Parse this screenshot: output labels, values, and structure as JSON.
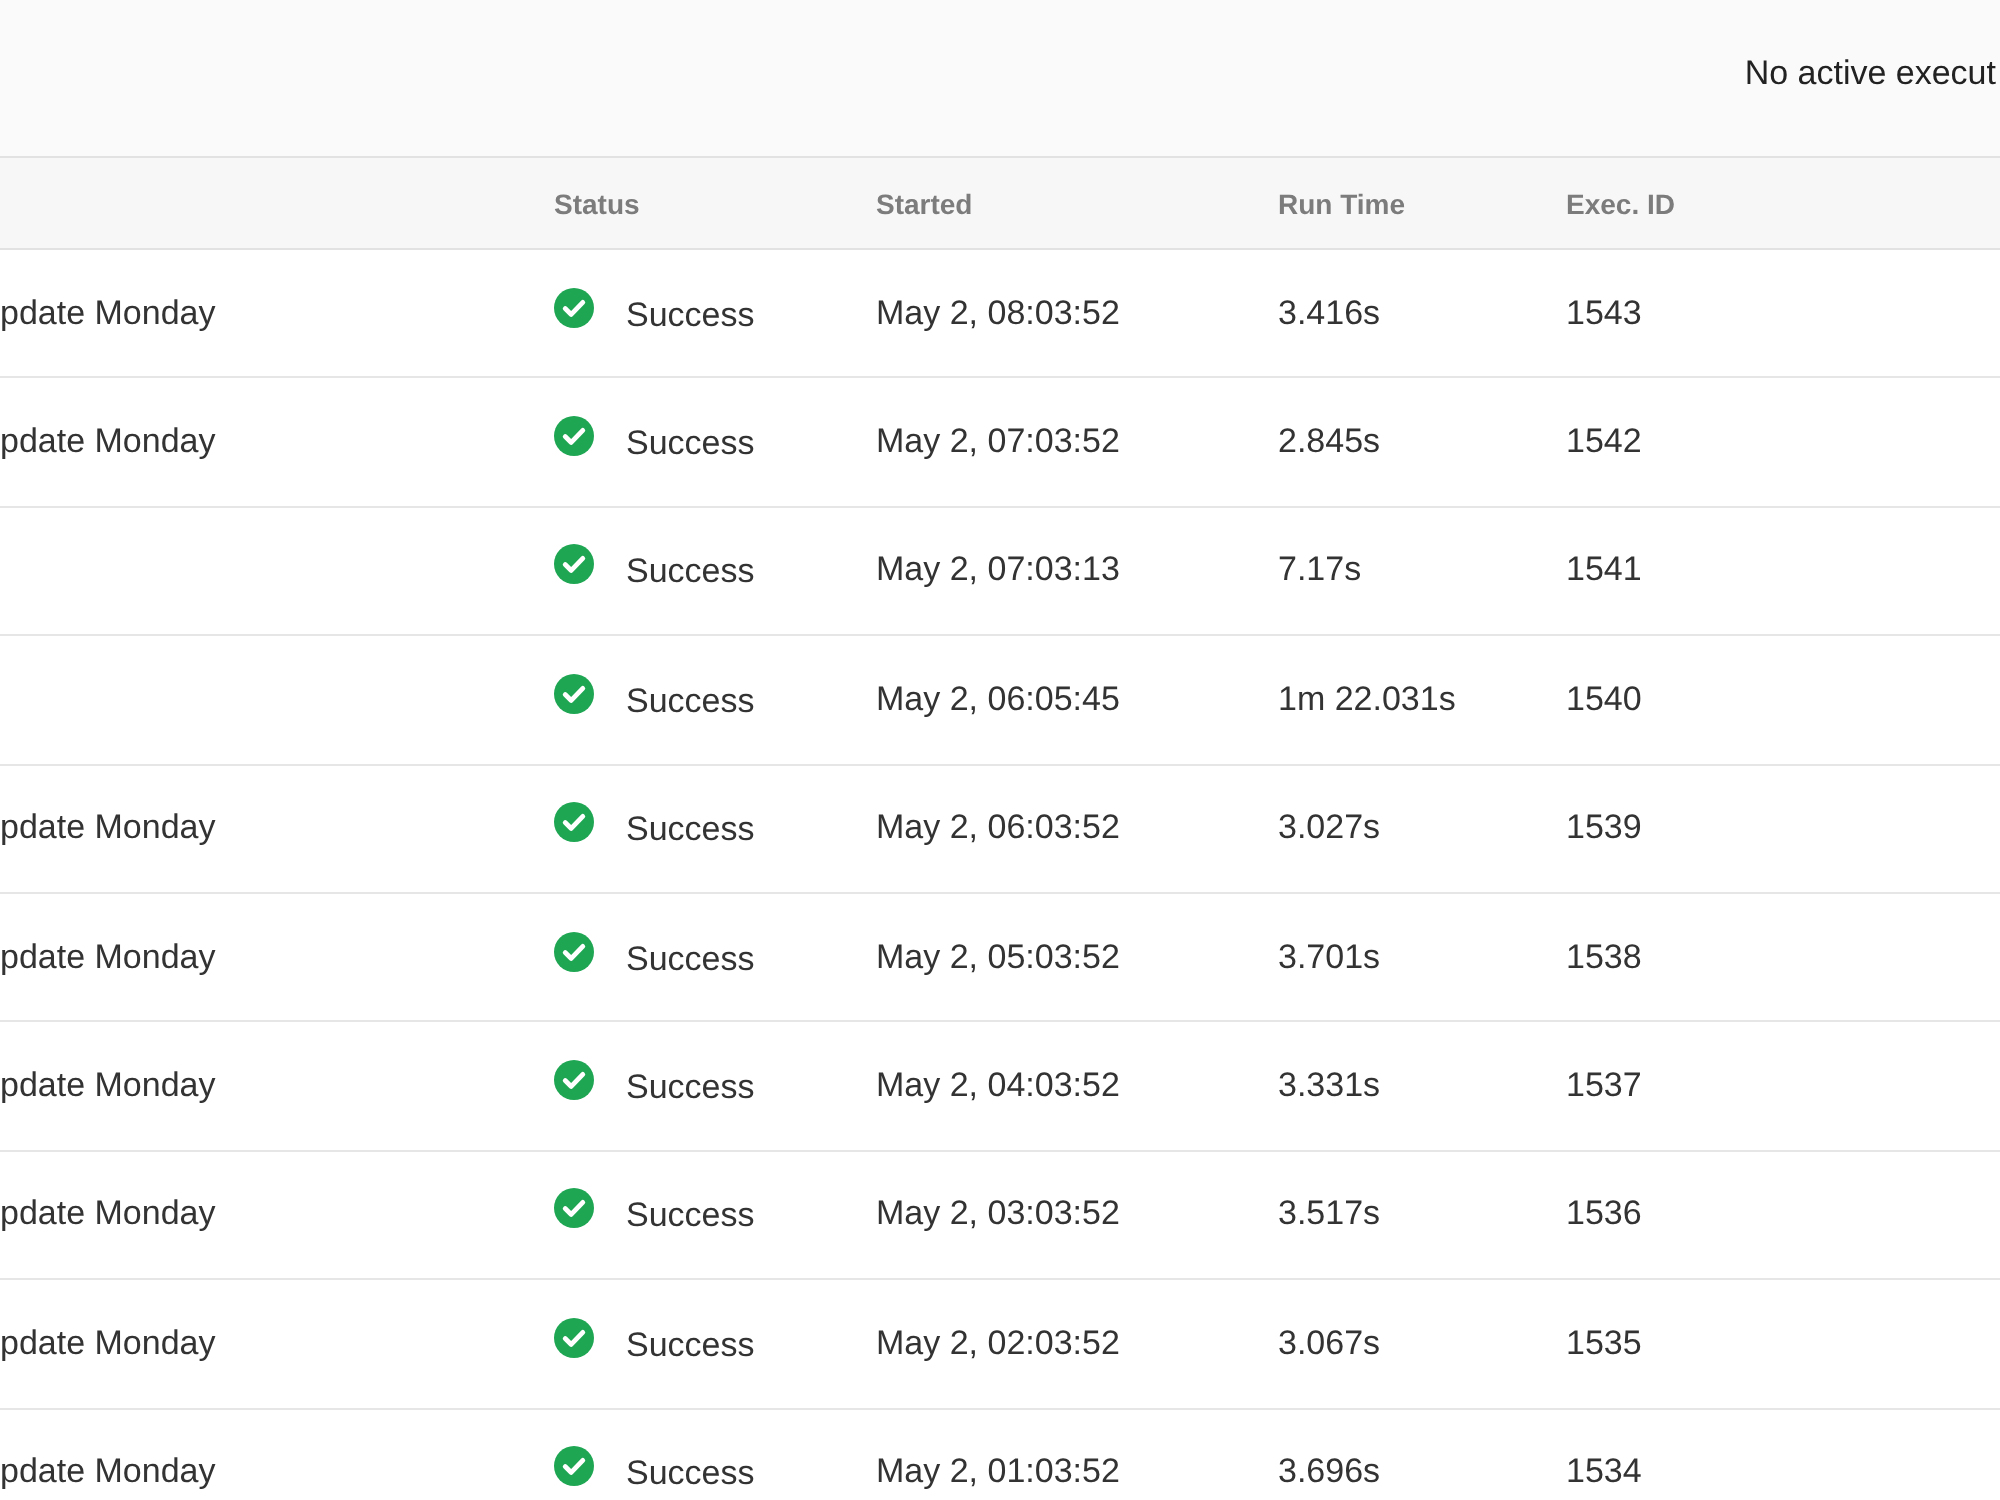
{
  "top_bar": {
    "message": "No active execut"
  },
  "table": {
    "columns": [
      "Status",
      "Started",
      "Run Time",
      "Exec. ID"
    ],
    "rows": [
      {
        "column_1": "pdate Monday",
        "status": "Success",
        "started": "May 2, 08:03:52",
        "run_time": "3.416s",
        "exec_id": "1543"
      },
      {
        "column_1": "pdate Monday",
        "status": "Success",
        "started": "May 2, 07:03:52",
        "run_time": "2.845s",
        "exec_id": "1542"
      },
      {
        "status": "Success",
        "started": "May 2, 07:03:13",
        "run_time": "7.17s",
        "exec_id": "1541"
      },
      {
        "status": "Success",
        "started": "May 2, 06:05:45",
        "run_time": "1m 22.031s",
        "exec_id": "1540"
      },
      {
        "column_1": "pdate Monday",
        "status": "Success",
        "started": "May 2, 06:03:52",
        "run_time": "3.027s",
        "exec_id": "1539"
      },
      {
        "column_1": "pdate Monday",
        "status": "Success",
        "started": "May 2, 05:03:52",
        "run_time": "3.701s",
        "exec_id": "1538"
      },
      {
        "column_1": "pdate Monday",
        "status": "Success",
        "started": "May 2, 04:03:52",
        "run_time": "3.331s",
        "exec_id": "1537"
      },
      {
        "column_1": "pdate Monday",
        "status": "Success",
        "started": "May 2, 03:03:52",
        "run_time": "3.517s",
        "exec_id": "1536"
      },
      {
        "column_1": "pdate Monday",
        "status": "Success",
        "started": "May 2, 02:03:52",
        "run_time": "3.067s",
        "exec_id": "1535"
      },
      {
        "column_1": "pdate Monday",
        "status": "Success",
        "started": "May 2, 01:03:52",
        "run_time": "3.696s",
        "exec_id": "1534"
      }
    ]
  }
}
